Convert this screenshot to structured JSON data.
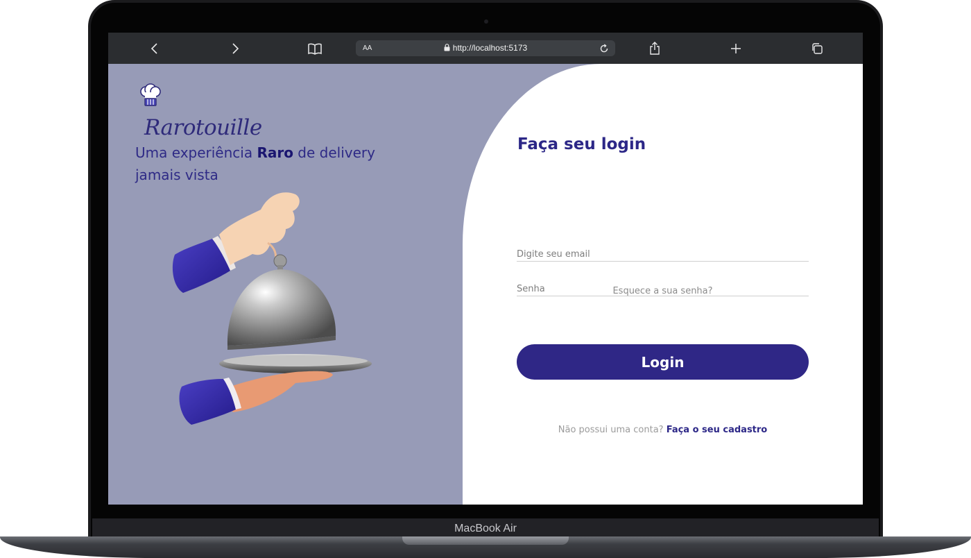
{
  "device": {
    "label": "MacBook Air"
  },
  "browser": {
    "text_size_label": "AA",
    "url": "http://localhost:5173",
    "icons": [
      "back-icon",
      "forward-icon",
      "bookmarks-icon",
      "lock-icon",
      "reload-icon",
      "share-icon",
      "new-tab-icon",
      "tabs-icon"
    ]
  },
  "brand": {
    "name": "Rarotouille",
    "tagline_prefix": "Uma experiência ",
    "tagline_bold": "Raro",
    "tagline_suffix": " de delivery jamais vista"
  },
  "login": {
    "title": "Faça seu login",
    "email_placeholder": "Digite seu email",
    "password_placeholder": "Senha",
    "forgot_link": "Esquece a sua senha?",
    "submit_label": "Login",
    "signup_prompt": "Não possui uma conta? ",
    "signup_link": "Faça o seu cadastro"
  },
  "colors": {
    "left_panel": "#979bb7",
    "primary": "#2f2786",
    "browser_bar": "#2b2d30"
  }
}
